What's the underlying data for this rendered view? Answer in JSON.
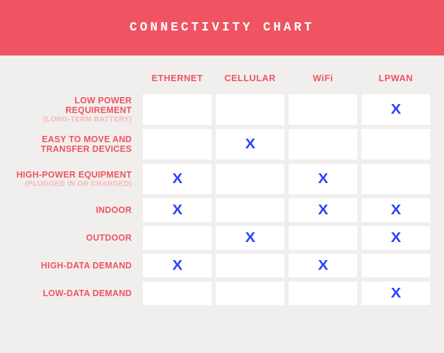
{
  "header": {
    "title": "CONNECTIVITY CHART"
  },
  "columns": [
    "ETHERNET",
    "CELLULAR",
    "WiFi",
    "LPWAN"
  ],
  "rows": [
    {
      "label": "LOW POWER REQUIREMENT",
      "sub": "(LONG-TERM BATTERY)",
      "marks": [
        false,
        false,
        false,
        true
      ],
      "tall": true
    },
    {
      "label": "EASY TO MOVE AND TRANSFER DEVICES",
      "sub": "",
      "marks": [
        false,
        true,
        false,
        false
      ],
      "tall": true
    },
    {
      "label": "HIGH-POWER EQUIPMENT",
      "sub": "(PLUGGED IN OR CHARGED)",
      "marks": [
        true,
        false,
        true,
        false
      ],
      "tall": true
    },
    {
      "label": "INDOOR",
      "sub": "",
      "marks": [
        true,
        false,
        true,
        true
      ],
      "tall": false
    },
    {
      "label": "OUTDOOR",
      "sub": "",
      "marks": [
        false,
        true,
        false,
        true
      ],
      "tall": false
    },
    {
      "label": "HIGH-DATA DEMAND",
      "sub": "",
      "marks": [
        true,
        false,
        true,
        false
      ],
      "tall": false
    },
    {
      "label": "LOW-DATA DEMAND",
      "sub": "",
      "marks": [
        false,
        false,
        false,
        true
      ],
      "tall": false
    }
  ],
  "mark_glyph": "X",
  "chart_data": {
    "type": "table",
    "title": "CONNECTIVITY CHART",
    "columns": [
      "ETHERNET",
      "CELLULAR",
      "WiFi",
      "LPWAN"
    ],
    "rows": [
      "LOW POWER REQUIREMENT (LONG-TERM BATTERY)",
      "EASY TO MOVE AND TRANSFER DEVICES",
      "HIGH-POWER EQUIPMENT (PLUGGED IN OR CHARGED)",
      "INDOOR",
      "OUTDOOR",
      "HIGH-DATA DEMAND",
      "LOW-DATA DEMAND"
    ],
    "values": [
      [
        0,
        0,
        0,
        1
      ],
      [
        0,
        1,
        0,
        0
      ],
      [
        1,
        0,
        1,
        0
      ],
      [
        1,
        0,
        1,
        1
      ],
      [
        0,
        1,
        0,
        1
      ],
      [
        1,
        0,
        1,
        0
      ],
      [
        0,
        0,
        0,
        1
      ]
    ]
  }
}
